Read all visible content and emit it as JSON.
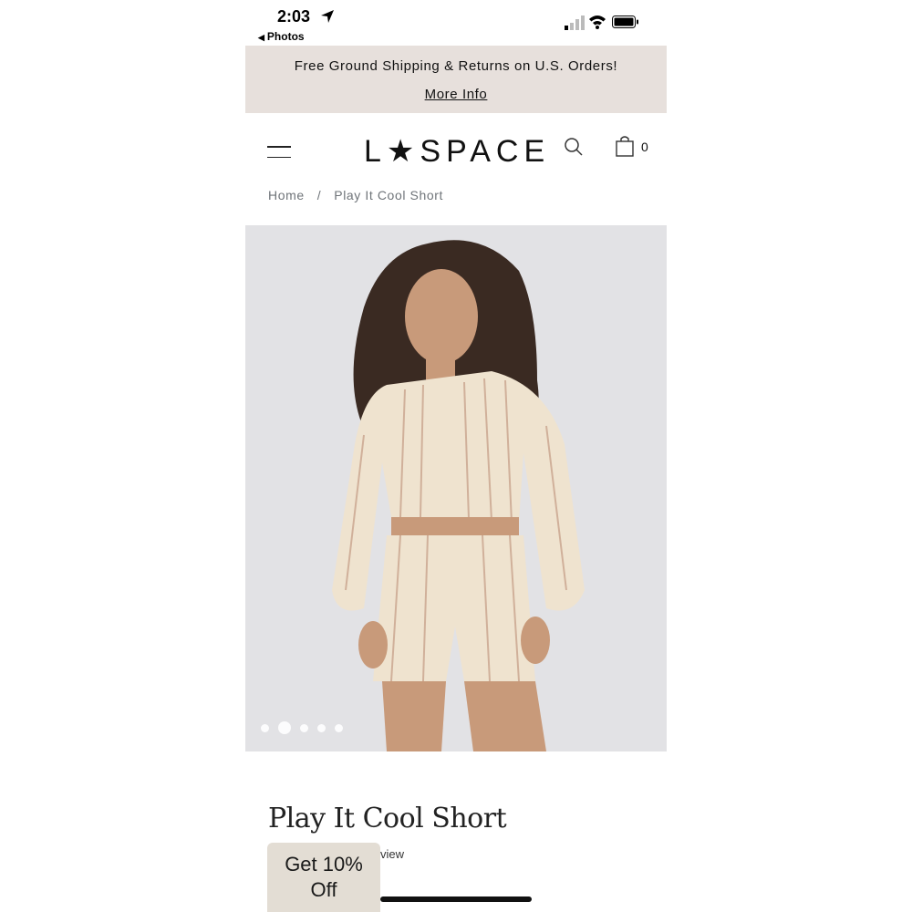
{
  "status_bar": {
    "time": "2:03",
    "back_app": "Photos"
  },
  "promo": {
    "text": "Free Ground Shipping & Returns on U.S. Orders!",
    "link": "More Info"
  },
  "header": {
    "logo": "L★SPACE",
    "cart_count": "0"
  },
  "breadcrumb": {
    "home": "Home",
    "separator": "/",
    "current": "Play It Cool Short"
  },
  "gallery": {
    "dot_count": 5,
    "active_index": 1
  },
  "product": {
    "title": "Play It Cool Short",
    "review_text": "view"
  },
  "discount_tab": {
    "line1": "Get 10%",
    "line2": "Off"
  },
  "colors": {
    "promo_bg": "#e7e0dc",
    "discount_bg": "#e3ddd4",
    "image_bg": "#e2e2e5"
  }
}
